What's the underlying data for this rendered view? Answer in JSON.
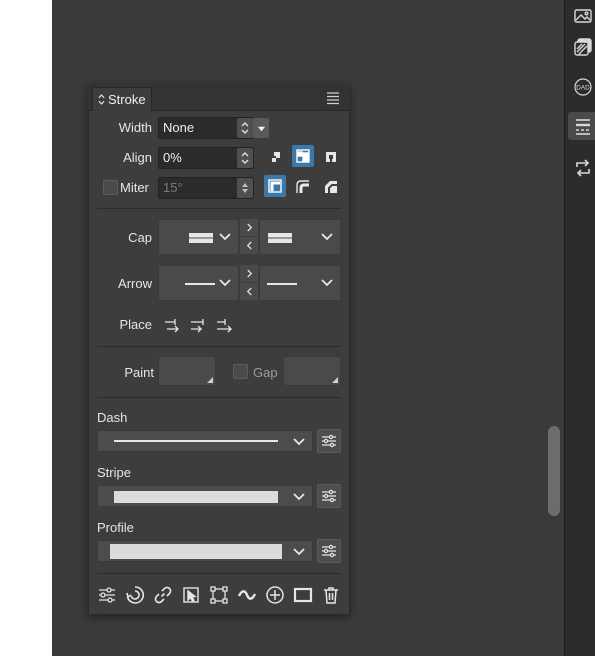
{
  "panel": {
    "tab_label": "Stroke",
    "width": {
      "label": "Width",
      "value": "None"
    },
    "align": {
      "label": "Align",
      "value": "0%"
    },
    "miter": {
      "label": "Miter",
      "value": "15°",
      "checked": false
    },
    "cap": {
      "label": "Cap"
    },
    "arrow": {
      "label": "Arrow"
    },
    "place": {
      "label": "Place"
    },
    "paint": {
      "label": "Paint"
    },
    "gap": {
      "label": "Gap",
      "checked": false
    },
    "dash": {
      "label": "Dash"
    },
    "stripe": {
      "label": "Stripe"
    },
    "profile": {
      "label": "Profile"
    }
  },
  "colors": {
    "accent": "#3c78a8",
    "panel_bg": "#3d3d3d",
    "canvas_bg": "#3a3a3a",
    "rail_bg": "#2c2c2c"
  },
  "right_rail_icons": [
    "image-icon",
    "layers-icon",
    "dad-icon",
    "stroke-panel-icon",
    "swap-icon"
  ],
  "toolbar_icons": [
    "settings-sliders-icon",
    "spiral-icon",
    "link-icon",
    "select-arrow-icon",
    "transform-box-icon",
    "wave-icon",
    "add-circle-icon",
    "rectangle-icon",
    "trash-icon"
  ]
}
